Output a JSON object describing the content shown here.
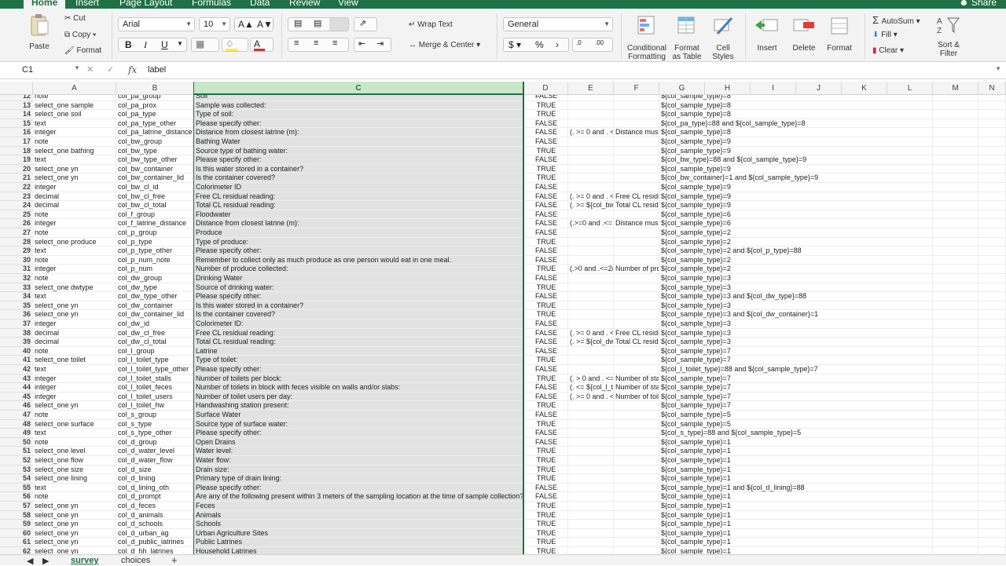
{
  "menu_tabs": [
    "Home",
    "Insert",
    "Page Layout",
    "Formulas",
    "Data",
    "Review",
    "View"
  ],
  "share_label": "Share",
  "clipboard": {
    "paste": "Paste",
    "cut": "Cut",
    "copy": "Copy",
    "format": "Format"
  },
  "font": {
    "name": "Arial",
    "size": "10"
  },
  "alignment": {
    "wrap_text": "Wrap Text",
    "merge_center": "Merge & Center"
  },
  "number": {
    "format": "General"
  },
  "styles": {
    "conditional": [
      "Conditional",
      "Formatting"
    ],
    "format_table": [
      "Format",
      "as Table"
    ],
    "cell_styles": [
      "Cell",
      "Styles"
    ]
  },
  "cells": {
    "insert": "Insert",
    "delete": "Delete",
    "format": "Format"
  },
  "editing": {
    "autosum": "AutoSum",
    "fill": "Fill",
    "clear": "Clear",
    "sort_filter": [
      "Sort &",
      "Filter"
    ]
  },
  "formula_bar": {
    "cell_ref": "C1",
    "fx": "fx",
    "value": "label"
  },
  "columns": [
    "A",
    "B",
    "C",
    "D",
    "E",
    "F",
    "G",
    "H",
    "I",
    "J",
    "K",
    "L",
    "M",
    "N"
  ],
  "selected_column": "C",
  "rows": [
    {
      "n": "12",
      "a": "note",
      "b": "col_pa_group",
      "c": "Soil",
      "d": "FALSE",
      "e": "",
      "f": "",
      "g": "${col_sample_type}=8"
    },
    {
      "n": "13",
      "a": "select_one sample",
      "b": "col_pa_prox",
      "c": "Sample was collected:",
      "d": "TRUE",
      "e": "",
      "f": "",
      "g": "${col_sample_type}=8"
    },
    {
      "n": "14",
      "a": "select_one soil",
      "b": "col_pa_type",
      "c": "Type of soil:",
      "d": "TRUE",
      "e": "",
      "f": "",
      "g": "${col_sample_type}=8"
    },
    {
      "n": "15",
      "a": "text",
      "b": "col_pa_type_other",
      "c": "Please specify other:",
      "d": "FALSE",
      "e": "",
      "f": "",
      "g": "${col_pa_type}=88 and ${col_sample_type}=8"
    },
    {
      "n": "16",
      "a": "integer",
      "b": "col_pa_latrine_distance",
      "c": "Distance from closest latrine (m):",
      "d": "FALSE",
      "e": "(. >= 0 and . <",
      "f": "Distance must",
      "g": "${col_sample_type}=8"
    },
    {
      "n": "17",
      "a": "note",
      "b": "col_bw_group",
      "c": "Bathing Water",
      "d": "FALSE",
      "e": "",
      "f": "",
      "g": "${col_sample_type}=9"
    },
    {
      "n": "18",
      "a": "select_one bathing",
      "b": "col_bw_type",
      "c": "Source type of bathing water:",
      "d": "TRUE",
      "e": "",
      "f": "",
      "g": "${col_sample_type}=9"
    },
    {
      "n": "19",
      "a": "text",
      "b": "col_bw_type_other",
      "c": "Please specify other:",
      "d": "FALSE",
      "e": "",
      "f": "",
      "g": "${col_bw_type}=88 and ${col_sample_type}=9"
    },
    {
      "n": "20",
      "a": "select_one yn",
      "b": "col_bw_container",
      "c": "Is this water stored in a container?",
      "d": "TRUE",
      "e": "",
      "f": "",
      "g": "${col_sample_type}=9"
    },
    {
      "n": "21",
      "a": "select_one yn",
      "b": "col_bw_container_lid",
      "c": "Is the container covered?",
      "d": "TRUE",
      "e": "",
      "f": "",
      "g": "${col_bw_container}=1 and ${col_sample_type}=9"
    },
    {
      "n": "22",
      "a": "integer",
      "b": "col_bw_cl_id",
      "c": "Colorimeter ID",
      "d": "FALSE",
      "e": "",
      "f": "",
      "g": "${col_sample_type}=9"
    },
    {
      "n": "23",
      "a": "decimal",
      "b": "col_bw_cl_free",
      "c": "Free CL residual reading:",
      "d": "FALSE",
      "e": "(. >= 0 and . <",
      "f": "Free CL residi",
      "g": "${col_sample_type}=9"
    },
    {
      "n": "24",
      "a": "decimal",
      "b": "col_bw_cl_total",
      "c": "Total CL residual reading:",
      "d": "FALSE",
      "e": "(. >= ${col_bw",
      "f": "Total CL resid",
      "g": "${col_sample_type}=9"
    },
    {
      "n": "25",
      "a": "note",
      "b": "col_f_group",
      "c": "Floodwater",
      "d": "FALSE",
      "e": "",
      "f": "",
      "g": "${col_sample_type}=6"
    },
    {
      "n": "26",
      "a": "integer",
      "b": "col_f_latrine_distance",
      "c": "Distance from closest latrine (m):",
      "d": "FALSE",
      "e": "(.>=0 and .<=",
      "f": "Distance must",
      "g": "${col_sample_type}=6"
    },
    {
      "n": "27",
      "a": "note",
      "b": "col_p_group",
      "c": "Produce",
      "d": "FALSE",
      "e": "",
      "f": "",
      "g": "${col_sample_type}=2"
    },
    {
      "n": "28",
      "a": "select_one produce",
      "b": "col_p_type",
      "c": "Type of produce:",
      "d": "TRUE",
      "e": "",
      "f": "",
      "g": "${col_sample_type}=2"
    },
    {
      "n": "29",
      "a": "text",
      "b": "col_p_type_other",
      "c": "Please specify other:",
      "d": "FALSE",
      "e": "",
      "f": "",
      "g": "${col_sample_type}=2 and ${col_p_type}=88"
    },
    {
      "n": "30",
      "a": "note",
      "b": "col_p_num_note",
      "c": "Remember to collect only as much produce as one person would eat in one meal.",
      "d": "FALSE",
      "e": "",
      "f": "",
      "g": "${col_sample_type}=2"
    },
    {
      "n": "31",
      "a": "integer",
      "b": "col_p_num",
      "c": "Number of produce collected:",
      "d": "TRUE",
      "e": "(.>0 and .<=2(",
      "f": "Number of pro",
      "g": "${col_sample_type}=2"
    },
    {
      "n": "32",
      "a": "note",
      "b": "col_dw_group",
      "c": "Drinking Water",
      "d": "FALSE",
      "e": "",
      "f": "",
      "g": "${col_sample_type}=3"
    },
    {
      "n": "33",
      "a": "select_one dwtype",
      "b": "col_dw_type",
      "c": "Source of drinking water:",
      "d": "TRUE",
      "e": "",
      "f": "",
      "g": "${col_sample_type}=3"
    },
    {
      "n": "34",
      "a": "text",
      "b": "col_dw_type_other",
      "c": "Please specify other:",
      "d": "FALSE",
      "e": "",
      "f": "",
      "g": "${col_sample_type}=3 and ${col_dw_type}=88"
    },
    {
      "n": "35",
      "a": "select_one yn",
      "b": "col_dw_container",
      "c": "Is this water stored in a container?",
      "d": "TRUE",
      "e": "",
      "f": "",
      "g": "${col_sample_type}=3"
    },
    {
      "n": "36",
      "a": "select_one yn",
      "b": "col_dw_container_lid",
      "c": "Is the container covered?",
      "d": "TRUE",
      "e": "",
      "f": "",
      "g": "${col_sample_type}=3 and ${col_dw_container}=1"
    },
    {
      "n": "37",
      "a": "integer",
      "b": "col_dw_id",
      "c": "Colorimeter ID:",
      "d": "FALSE",
      "e": "",
      "f": "",
      "g": "${col_sample_type}=3"
    },
    {
      "n": "38",
      "a": "decimal",
      "b": "col_dw_cl_free",
      "c": "Free CL residual reading:",
      "d": "FALSE",
      "e": "(. >= 0 and . <",
      "f": "Free CL residi",
      "g": "${col_sample_type}=3"
    },
    {
      "n": "39",
      "a": "decimal",
      "b": "col_dw_cl_total",
      "c": "Total CL residual reading:",
      "d": "FALSE",
      "e": "(. >= ${col_dw",
      "f": "Total CL resid",
      "g": "${col_sample_type}=3"
    },
    {
      "n": "40",
      "a": "note",
      "b": "col_l_group",
      "c": "Latrine",
      "d": "FALSE",
      "e": "",
      "f": "",
      "g": "${col_sample_type}=7"
    },
    {
      "n": "41",
      "a": "select_one toilet",
      "b": "col_l_toilet_type",
      "c": "Type of toilet:",
      "d": "TRUE",
      "e": "",
      "f": "",
      "g": "${col_sample_type}=7"
    },
    {
      "n": "42",
      "a": "text",
      "b": "col_l_toilet_type_other",
      "c": "Please specify other:",
      "d": "FALSE",
      "e": "",
      "f": "",
      "g": "${col_l_toilet_type}=88 and ${col_sample_type}=7"
    },
    {
      "n": "43",
      "a": "integer",
      "b": "col_l_toilet_stalls",
      "c": "Number of toilets per block:",
      "d": "TRUE",
      "e": "(. > 0 and . <=",
      "f": "Number of sta",
      "g": "${col_sample_type}=7"
    },
    {
      "n": "44",
      "a": "integer",
      "b": "col_l_toilet_feces",
      "c": "Number of toilets in block with feces visible on walls and/or slabs:",
      "d": "FALSE",
      "e": "(. <= ${col_l_t",
      "f": "Number of sta",
      "g": "${col_sample_type}=7"
    },
    {
      "n": "45",
      "a": "integer",
      "b": "col_l_toilet_users",
      "c": "Number of toilet users per day:",
      "d": "FALSE",
      "e": "(. >= 0 and . <",
      "f": "Number of toil",
      "g": "${col_sample_type}=7"
    },
    {
      "n": "46",
      "a": "select_one yn",
      "b": "col_l_toilet_hw",
      "c": "Handwashing station present:",
      "d": "TRUE",
      "e": "",
      "f": "",
      "g": "${col_sample_type}=7"
    },
    {
      "n": "47",
      "a": "note",
      "b": "col_s_group",
      "c": "Surface Water",
      "d": "FALSE",
      "e": "",
      "f": "",
      "g": "${col_sample_type}=5"
    },
    {
      "n": "48",
      "a": "select_one surface",
      "b": "col_s_type",
      "c": "Source type of surface water:",
      "d": "TRUE",
      "e": "",
      "f": "",
      "g": "${col_sample_type}=5"
    },
    {
      "n": "49",
      "a": "text",
      "b": "col_s_type_other",
      "c": "Please specify other:",
      "d": "FALSE",
      "e": "",
      "f": "",
      "g": "${col_s_type}=88 and ${col_sample_type}=5"
    },
    {
      "n": "50",
      "a": "note",
      "b": "col_d_group",
      "c": "Open Drains",
      "d": "FALSE",
      "e": "",
      "f": "",
      "g": "${col_sample_type}=1"
    },
    {
      "n": "51",
      "a": "select_one level",
      "b": "col_d_water_level",
      "c": "Water level:",
      "d": "TRUE",
      "e": "",
      "f": "",
      "g": "${col_sample_type}=1"
    },
    {
      "n": "52",
      "a": "select_one flow",
      "b": "col_d_water_flow",
      "c": "Water flow:",
      "d": "TRUE",
      "e": "",
      "f": "",
      "g": "${col_sample_type}=1"
    },
    {
      "n": "53",
      "a": "select_one size",
      "b": "col_d_size",
      "c": "Drain size:",
      "d": "TRUE",
      "e": "",
      "f": "",
      "g": "${col_sample_type}=1"
    },
    {
      "n": "54",
      "a": "select_one lining",
      "b": "col_d_lining",
      "c": "Primary type of drain lining:",
      "d": "TRUE",
      "e": "",
      "f": "",
      "g": "${col_sample_type}=1"
    },
    {
      "n": "55",
      "a": "text",
      "b": "col_d_lining_oth",
      "c": "Please specify other:",
      "d": "FALSE",
      "e": "",
      "f": "",
      "g": "${col_sample_type}=1 and ${col_d_lining}=88"
    },
    {
      "n": "56",
      "a": "note",
      "b": "col_d_prompt",
      "c": "Are any of the following present within 3 meters of the sampling location at the time of sample collection?",
      "d": "FALSE",
      "e": "",
      "f": "",
      "g": "${col_sample_type}=1"
    },
    {
      "n": "57",
      "a": "select_one yn",
      "b": "col_d_feces",
      "c": "Feces",
      "d": "TRUE",
      "e": "",
      "f": "",
      "g": "${col_sample_type}=1"
    },
    {
      "n": "58",
      "a": "select_one yn",
      "b": "col_d_animals",
      "c": "Animals",
      "d": "TRUE",
      "e": "",
      "f": "",
      "g": "${col_sample_type}=1"
    },
    {
      "n": "59",
      "a": "select_one yn",
      "b": "col_d_schools",
      "c": "Schools",
      "d": "TRUE",
      "e": "",
      "f": "",
      "g": "${col_sample_type}=1"
    },
    {
      "n": "60",
      "a": "select_one yn",
      "b": "col_d_urban_ag",
      "c": "Urban Agriculture Sites",
      "d": "TRUE",
      "e": "",
      "f": "",
      "g": "${col_sample_type}=1"
    },
    {
      "n": "61",
      "a": "select_one yn",
      "b": "col_d_public_latrines",
      "c": "Public Latrines",
      "d": "TRUE",
      "e": "",
      "f": "",
      "g": "${col_sample_type}=1"
    },
    {
      "n": "62",
      "a": "select_one yn",
      "b": "col_d_hh_latrines",
      "c": "Household Latrines",
      "d": "TRUE",
      "e": "",
      "f": "",
      "g": "${col_sample_type}=1"
    }
  ],
  "sheets": [
    "survey",
    "choices"
  ],
  "active_sheet": "survey",
  "colors": {
    "accent": "#1e7145",
    "selected_col": "#c8e6c9",
    "selected_cells": "#e2e2e2"
  }
}
